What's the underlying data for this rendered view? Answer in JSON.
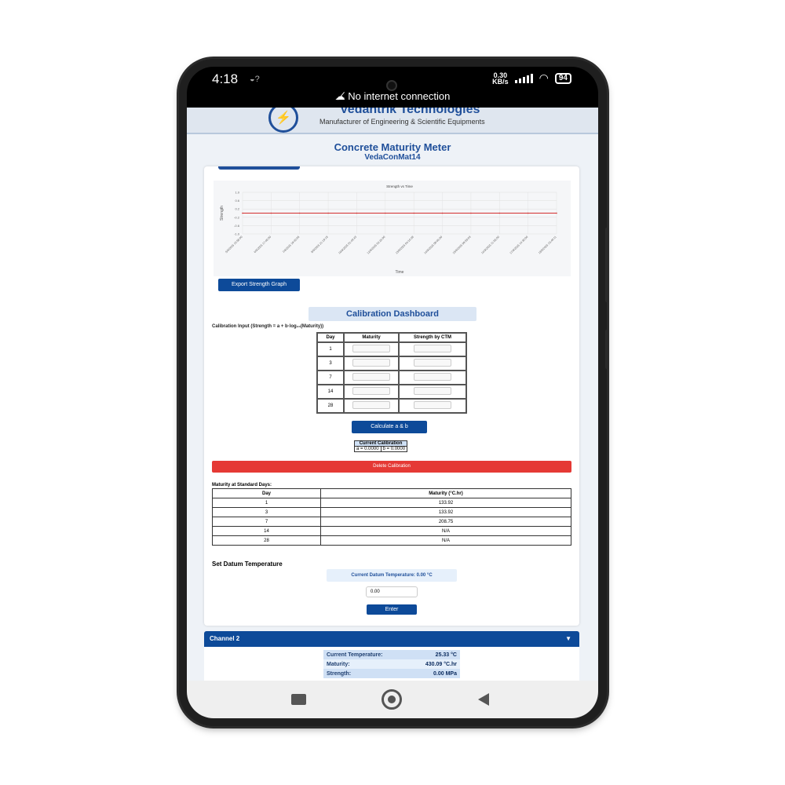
{
  "status_bar": {
    "time": "4:18",
    "net_speed_value": "0.30",
    "net_speed_unit": "KB/s",
    "battery": "94",
    "no_internet": "No internet connection"
  },
  "header": {
    "company": "Vedantrik Technologies",
    "tagline": "Manufacturer of Engineering & Scientific Equipments"
  },
  "page": {
    "title": "Concrete Maturity Meter",
    "device": "VedaConMat14"
  },
  "chart_data": {
    "type": "line",
    "title": "Strength vs Time",
    "xlabel": "Time",
    "ylabel": "Strength",
    "ylim": [
      -1.0,
      1.0
    ],
    "y_ticks": [
      "1.0",
      "0.6",
      "0.2",
      "-0.2",
      "-0.6",
      "-1.0"
    ],
    "x_ticks": [
      "5/9/2025 15:58:00",
      "6/9/2025 17:48:00",
      "7/9/2025 19:40:05",
      "8/9/2025 21:19:18",
      "10/9/2025 01:49:43",
      "12/9/2025 02:26:00",
      "13/9/2025 04:10:38",
      "14/9/2025 08:06:00",
      "15/9/2025 09:59:03",
      "16/9/2025 11:55:00",
      "17/9/2025 14:30:00",
      "18/9/2025 15:40:11"
    ],
    "series": [
      {
        "color": "#d32f2f",
        "values": [
          0,
          0,
          0,
          0,
          0,
          0,
          0,
          0,
          0,
          0,
          0,
          0
        ]
      }
    ],
    "grid": true
  },
  "export_button": "Export Strength Graph",
  "calibration": {
    "title": "Calibration Dashboard",
    "input_label": "Calibration Input (Strength = a + b·log₁₀(Maturity))",
    "headers": [
      "Day",
      "Maturity",
      "Strength by CTM"
    ],
    "days": [
      "1",
      "3",
      "7",
      "14",
      "28"
    ],
    "calculate_button": "Calculate a & b",
    "current_label": "Current Calibration",
    "a_value": "a = 0.0000",
    "b_value": "b = 0.0000",
    "delete_button": "Delete Calibration"
  },
  "maturity": {
    "label": "Maturity at Standard Days:",
    "headers": [
      "Day",
      "Maturity (°C.hr)"
    ],
    "rows": [
      [
        "1",
        "133.92"
      ],
      [
        "3",
        "133.92"
      ],
      [
        "7",
        "208.75"
      ],
      [
        "14",
        "N/A"
      ],
      [
        "28",
        "N/A"
      ]
    ]
  },
  "datum": {
    "label": "Set Datum Temperature",
    "current": "Current Datum Temperature: 0.00 °C",
    "input_value": "0.00",
    "enter_button": "Enter"
  },
  "channel2": {
    "title": "Channel 2",
    "rows": [
      [
        "Current Temperature:",
        "25.33 °C"
      ],
      [
        "Maturity:",
        "430.09 °C.hr"
      ],
      [
        "Strength:",
        "0.00 MPa"
      ]
    ]
  }
}
